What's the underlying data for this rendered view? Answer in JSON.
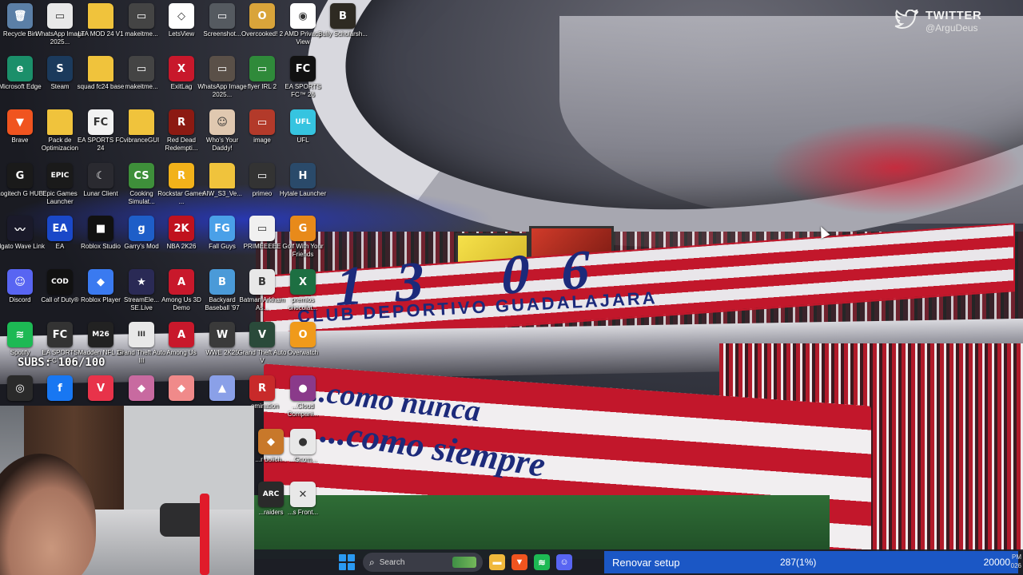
{
  "desktop": {
    "icons": [
      {
        "label": "Recycle Bin",
        "icon": "recycle-bin-icon",
        "color": "#5b7fa6",
        "glyph": "🗑"
      },
      {
        "label": "WhatsApp Image 2025...",
        "icon": "image-file-icon",
        "color": "#e8e8e8",
        "glyph": "▭"
      },
      {
        "label": "LTA MOD 24 V1",
        "icon": "folder-icon",
        "color": "#f0c33c",
        "glyph": ""
      },
      {
        "label": "makeitme...",
        "icon": "image-file-icon",
        "color": "#444444",
        "glyph": "▭"
      },
      {
        "label": "LetsView",
        "icon": "letsview-icon",
        "color": "#ffffff",
        "glyph": "◇"
      },
      {
        "label": "Screenshot...",
        "icon": "image-file-icon",
        "color": "#555a60",
        "glyph": "▭"
      },
      {
        "label": "Overcooked! 2",
        "icon": "overcooked-icon",
        "color": "#d9a43a",
        "glyph": "O"
      },
      {
        "label": "AMD Privacy View",
        "icon": "eye-icon",
        "color": "#ffffff",
        "glyph": "◉"
      },
      {
        "label": "Bully Scholarsh...",
        "icon": "bully-icon",
        "color": "#2e2a22",
        "glyph": "B"
      },
      {
        "label": "Microsoft Edge",
        "icon": "edge-icon",
        "color": "#1b8f6a",
        "glyph": "e"
      },
      {
        "label": "Steam",
        "icon": "steam-icon",
        "color": "#1b3a5c",
        "glyph": "S"
      },
      {
        "label": "squad fc24 base",
        "icon": "folder-icon",
        "color": "#f0c33c",
        "glyph": ""
      },
      {
        "label": "makeitme...",
        "icon": "image-file-icon",
        "color": "#444444",
        "glyph": "▭"
      },
      {
        "label": "ExitLag",
        "icon": "exitlag-icon",
        "color": "#c8182b",
        "glyph": "X"
      },
      {
        "label": "WhatsApp Image 2025...",
        "icon": "image-file-icon",
        "color": "#5a5048",
        "glyph": "▭"
      },
      {
        "label": "flyer IRL 2",
        "icon": "image-file-icon",
        "color": "#2f8a3a",
        "glyph": "▭"
      },
      {
        "label": "EA SPORTS FC™ 26",
        "icon": "fc26-icon",
        "color": "#111111",
        "glyph": "FC"
      },
      {
        "label": "Brave",
        "icon": "brave-icon",
        "color": "#f0541f",
        "glyph": "▼"
      },
      {
        "label": "Pack de Optimizacion",
        "icon": "folder-icon",
        "color": "#f0c33c",
        "glyph": ""
      },
      {
        "label": "EA SPORTS FC 24",
        "icon": "fc24-icon",
        "color": "#f2f2f2",
        "glyph": "FC"
      },
      {
        "label": "vibranceGUI",
        "icon": "folder-icon",
        "color": "#f0c33c",
        "glyph": ""
      },
      {
        "label": "Red Dead Redempti...",
        "icon": "rdr-icon",
        "color": "#8c1a12",
        "glyph": "R"
      },
      {
        "label": "Who's Your Daddy!",
        "icon": "whos-your-daddy-icon",
        "color": "#e0c8b0",
        "glyph": "☺"
      },
      {
        "label": "image",
        "icon": "image-file-icon",
        "color": "#b33a2a",
        "glyph": "▭"
      },
      {
        "label": "UFL",
        "icon": "ufl-icon",
        "color": "#36c4e0",
        "glyph": "UFL"
      },
      {
        "label": "Logitech G HUB",
        "icon": "logitech-icon",
        "color": "#1a1a1a",
        "glyph": "G"
      },
      {
        "label": "Epic Games Launcher",
        "icon": "epic-icon",
        "color": "#1a1a1a",
        "glyph": "EPIC"
      },
      {
        "label": "Lunar Client",
        "icon": "lunar-icon",
        "color": "#2a2a30",
        "glyph": "☾"
      },
      {
        "label": "Cooking Simulat...",
        "icon": "cooking-sim-icon",
        "color": "#3e8f3a",
        "glyph": "CS"
      },
      {
        "label": "Rockstar Games ...",
        "icon": "rockstar-icon",
        "color": "#f2b21a",
        "glyph": "R"
      },
      {
        "label": "AIW_S3_Ve...",
        "icon": "folder-icon",
        "color": "#f0c33c",
        "glyph": ""
      },
      {
        "label": "primeo",
        "icon": "file-icon",
        "color": "#333333",
        "glyph": "▭"
      },
      {
        "label": "Hytale Launcher",
        "icon": "hytale-icon",
        "color": "#2a4a6a",
        "glyph": "H"
      },
      {
        "label": "Elgato Wave Link",
        "icon": "elgato-icon",
        "color": "#1a1a2a",
        "glyph": "〰"
      },
      {
        "label": "EA",
        "icon": "ea-icon",
        "color": "#1a48c8",
        "glyph": "EA"
      },
      {
        "label": "Roblox Studio",
        "icon": "roblox-studio-icon",
        "color": "#111111",
        "glyph": "■"
      },
      {
        "label": "Garry's Mod",
        "icon": "gmod-icon",
        "color": "#1e5ec8",
        "glyph": "g"
      },
      {
        "label": "NBA 2K26",
        "icon": "nba2k-icon",
        "color": "#c0121e",
        "glyph": "2K"
      },
      {
        "label": "Fall Guys",
        "icon": "fallguys-icon",
        "color": "#4aa0e8",
        "glyph": "FG"
      },
      {
        "label": "PRIMEEEEE",
        "icon": "file-icon",
        "color": "#f0f0f0",
        "glyph": "▭"
      },
      {
        "label": "Golf With Your Friends",
        "icon": "golf-icon",
        "color": "#e88a1a",
        "glyph": "G"
      },
      {
        "label": "Discord",
        "icon": "discord-icon",
        "color": "#5865f2",
        "glyph": "☺"
      },
      {
        "label": "Call of Duty®",
        "icon": "cod-icon",
        "color": "#111111",
        "glyph": "COD"
      },
      {
        "label": "Roblox Player",
        "icon": "roblox-icon",
        "color": "#3a7af0",
        "glyph": "◆"
      },
      {
        "label": "StreamEle... SE.Live",
        "icon": "streamelements-icon",
        "color": "#2a2a55",
        "glyph": "★"
      },
      {
        "label": "Among Us 3D Demo",
        "icon": "among-us-icon",
        "color": "#c8182b",
        "glyph": "A"
      },
      {
        "label": "Backyard Baseball '97",
        "icon": "baseball-icon",
        "color": "#4a9ad8",
        "glyph": "B"
      },
      {
        "label": "Batman Arkham As...",
        "icon": "batman-icon",
        "color": "#e8e8e8",
        "glyph": "B"
      },
      {
        "label": "premios chocolat...",
        "icon": "excel-icon",
        "color": "#1d6f42",
        "glyph": "X"
      },
      {
        "label": "Spotify",
        "icon": "spotify-icon",
        "color": "#1db954",
        "glyph": "≋"
      },
      {
        "label": "EA SPORTS FC™ 25",
        "icon": "fc25-icon",
        "color": "#333333",
        "glyph": "FC"
      },
      {
        "label": "Madden NFL 26",
        "icon": "madden-icon",
        "color": "#222222",
        "glyph": "M26"
      },
      {
        "label": "Grand Theft Auto III",
        "icon": "gta3-icon",
        "color": "#e8e8e8",
        "glyph": "III"
      },
      {
        "label": "Among Us",
        "icon": "among-us-icon",
        "color": "#c8182b",
        "glyph": "A"
      },
      {
        "label": "WWE 2K25",
        "icon": "wwe-icon",
        "color": "#3a3a3a",
        "glyph": "W"
      },
      {
        "label": "Grand Theft Auto V",
        "icon": "gta5-icon",
        "color": "#2a4a3a",
        "glyph": "V"
      },
      {
        "label": "Overwatch",
        "icon": "overwatch-icon",
        "color": "#f09a1a",
        "glyph": "O"
      },
      {
        "label": "",
        "icon": "obs-icon",
        "color": "#2a2a2a",
        "glyph": "◎"
      },
      {
        "label": "",
        "icon": "facebook-icon",
        "color": "#1877f2",
        "glyph": "f"
      },
      {
        "label": "",
        "icon": "valorant-icon",
        "color": "#e8334a",
        "glyph": "V"
      },
      {
        "label": "",
        "icon": "app-icon",
        "color": "#c86aa0",
        "glyph": "◆"
      },
      {
        "label": "",
        "icon": "app-icon",
        "color": "#f08a8a",
        "glyph": "◆"
      },
      {
        "label": "",
        "icon": "app-icon",
        "color": "#8aa0e8",
        "glyph": "▲"
      },
      {
        "label": "...omination",
        "icon": "app-icon",
        "color": "#c82a2a",
        "glyph": "R"
      },
      {
        "label": "...Cloud Compani...",
        "icon": "app-icon",
        "color": "#8a3a8a",
        "glyph": "●"
      },
      {
        "label": "...r bolich...",
        "icon": "app-icon",
        "color": "#c8782a",
        "glyph": "◆"
      },
      {
        "label": "...Gnom...",
        "icon": "app-icon",
        "color": "#e8e8e8",
        "glyph": "●"
      },
      {
        "label": "...raiders",
        "icon": "arc-raiders-icon",
        "color": "#2a2a2a",
        "glyph": "ARC"
      },
      {
        "label": "...s Front...",
        "icon": "app-icon",
        "color": "#e8e8e8",
        "glyph": "✕"
      }
    ]
  },
  "overlay": {
    "twitter_title": "TWITTER",
    "twitter_handle": "@ArguDeus",
    "subs_text": "SUBS: 106/100"
  },
  "wallpaper": {
    "banner_top_number": "13 06",
    "banner_top_text": "CLUB DEPORTIVO GUADALAJARA",
    "banner_bottom_line1": "...como nunca",
    "banner_bottom_line2": "...como siempre",
    "colors": {
      "red": "#c2172b",
      "blue": "#1c2a7a",
      "white": "#f1eef0"
    }
  },
  "taskbar": {
    "search_placeholder": "Search",
    "pinned_icons": [
      {
        "icon": "file-explorer-icon",
        "color": "#f0b83c",
        "glyph": "▬"
      },
      {
        "icon": "brave-icon",
        "color": "#f0541f",
        "glyph": "▼"
      },
      {
        "icon": "spotify-icon",
        "color": "#1db954",
        "glyph": "≋"
      },
      {
        "icon": "discord-icon",
        "color": "#5865f2",
        "glyph": "☺"
      }
    ],
    "progress": {
      "label": "Renovar setup",
      "count": "287(1%)",
      "goal": "20000",
      "fraction": 0.01
    },
    "clock": {
      "line1": "PM",
      "line2": "026"
    }
  }
}
